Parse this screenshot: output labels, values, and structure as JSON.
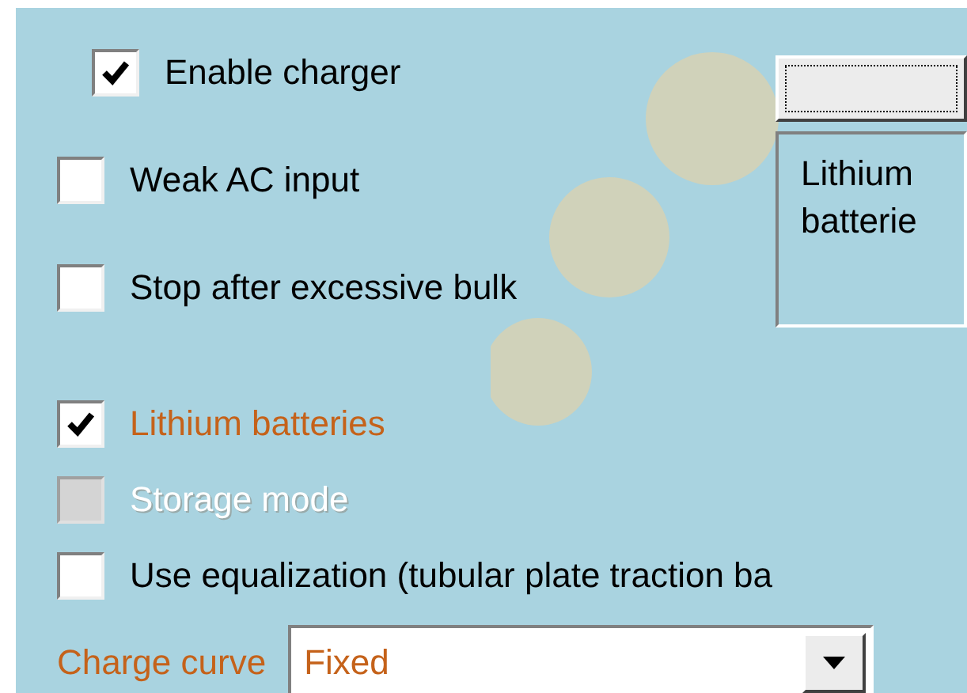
{
  "charger_options": [
    {
      "kind": "main",
      "label": "Enable charger",
      "checked": true,
      "disabled": false,
      "highlighted": false
    },
    {
      "kind": "option",
      "label": "Weak AC input",
      "checked": false,
      "disabled": false,
      "highlighted": false
    },
    {
      "kind": "option",
      "label": "Stop after excessive bulk",
      "checked": false,
      "disabled": false,
      "highlighted": false
    },
    {
      "kind": "option",
      "label": "Lithium batteries",
      "checked": true,
      "disabled": false,
      "highlighted": true
    },
    {
      "kind": "option",
      "label": "Storage mode",
      "checked": false,
      "disabled": true,
      "highlighted": false
    },
    {
      "kind": "option",
      "label": "Use equalization (tubular plate traction ba",
      "checked": false,
      "disabled": false,
      "highlighted": false
    }
  ],
  "charge_curve": {
    "label": "Charge curve",
    "value": "Fixed"
  },
  "info_box": {
    "lines": [
      "Lithium",
      "batterie"
    ]
  }
}
